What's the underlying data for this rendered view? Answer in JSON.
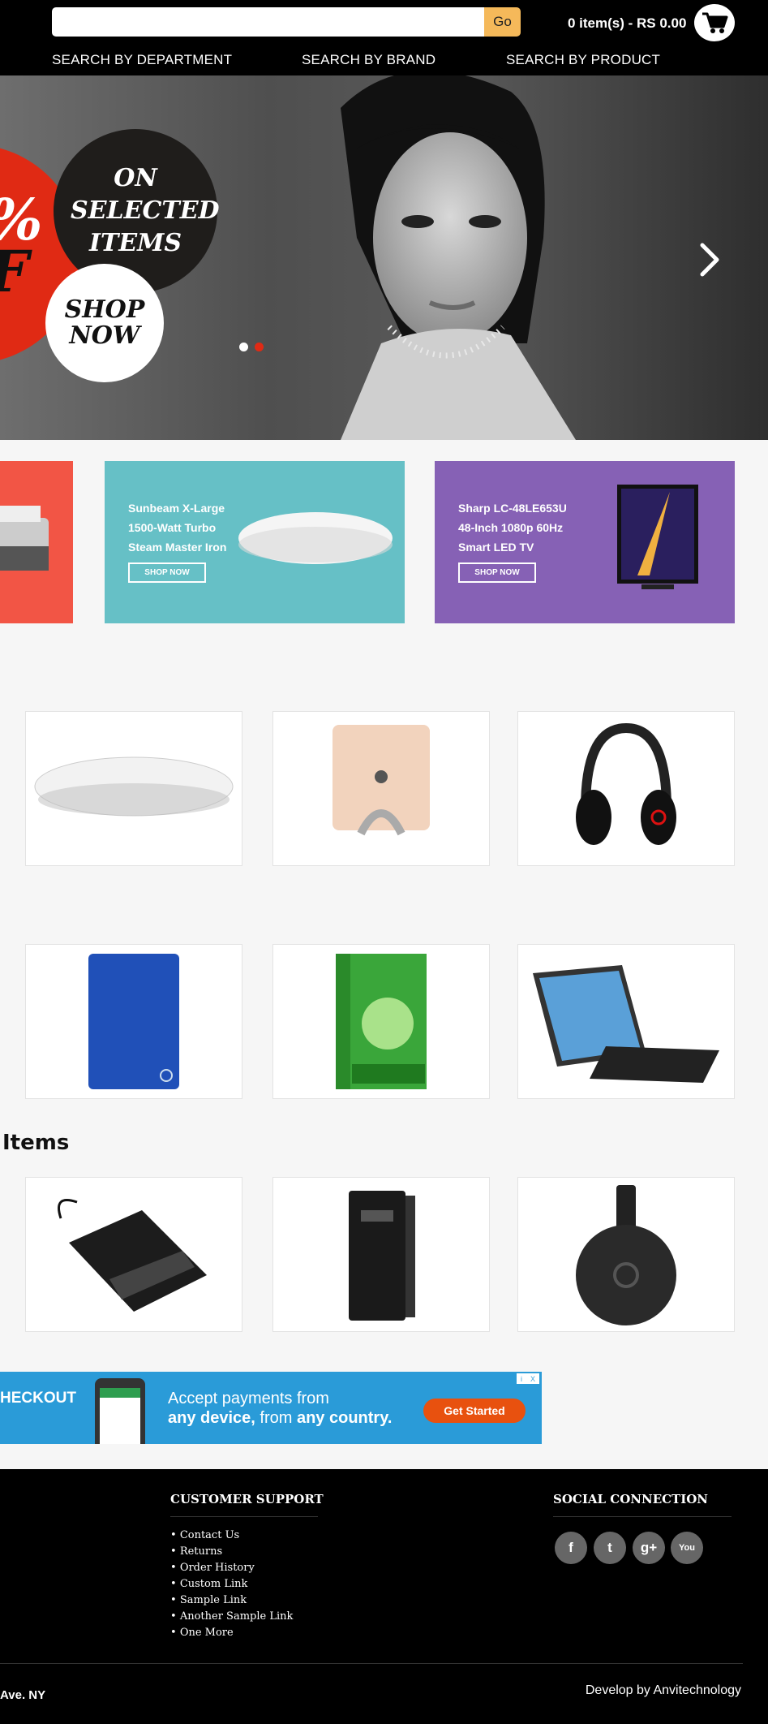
{
  "header": {
    "search_placeholder": "",
    "go_label": "Go",
    "cart_summary": "0 item(s) - RS 0.00",
    "cart_icon": "shopping-cart-icon",
    "nav": [
      "SEARCH BY DEPARTMENT",
      "SEARCH BY BRAND",
      "SEARCH BY PRODUCT"
    ]
  },
  "hero": {
    "percent_text": "%",
    "off_text": "F",
    "badge_text": "ON SELECTED ITEMS",
    "cta_text": "SHOP NOW",
    "next_icon": "chevron-right-icon",
    "slides_total": 2,
    "active_slide": 2,
    "dot_active_color": "#e02a14"
  },
  "promos": [
    {
      "title": "",
      "lines": [],
      "button": "",
      "bg": "#f25545"
    },
    {
      "title": "Sunbeam X-Large",
      "lines": [
        "1500-Watt Turbo",
        "Steam Master Iron"
      ],
      "button": "SHOP NOW",
      "bg": "#66c0c6"
    },
    {
      "title": "Sharp LC-48LE653U",
      "lines": [
        "48-Inch 1080p 60Hz",
        "Smart LED TV"
      ],
      "button": "SHOP NOW",
      "bg": "#8661b5"
    }
  ],
  "products": [
    {
      "image": "magic-mouse-image"
    },
    {
      "image": "laptop-stand-image"
    },
    {
      "image": "headphones-image"
    },
    {
      "image": "external-hard-drive-image"
    },
    {
      "image": "quick-heal-box-image"
    },
    {
      "image": "tablet-keyboard-image"
    }
  ],
  "section_title": "Items",
  "items": [
    {
      "image": "external-dvd-drive-image"
    },
    {
      "image": "apc-ups-image"
    },
    {
      "image": "chromecast-image"
    }
  ],
  "ad": {
    "left_text": "HECKOUT",
    "line1": "Accept payments from",
    "line2_a": "any device,",
    "line2_b": " from ",
    "line2_c": "any country.",
    "button": "Get Started",
    "info": "i",
    "close": "X"
  },
  "footer": {
    "support_title": "CUSTOMER SUPPORT",
    "support_links": [
      "Contact Us",
      "Returns",
      "Order History",
      "Custom Link",
      "Sample Link",
      "Another Sample Link",
      "One More"
    ],
    "social_title": "SOCIAL CONNECTION",
    "social_icons": [
      {
        "name": "facebook-icon",
        "glyph": "f"
      },
      {
        "name": "twitter-icon",
        "glyph": "t"
      },
      {
        "name": "google-plus-icon",
        "glyph": "g+"
      },
      {
        "name": "youtube-icon",
        "glyph": "You"
      }
    ],
    "address_fragment": "Ave. NY",
    "develop_text": "Develop by Anvitechnology"
  },
  "colors": {
    "accent": "#f5b95a",
    "header_bg": "#000000",
    "ad_bg": "#2a9bd8",
    "ad_button": "#e8510f"
  }
}
